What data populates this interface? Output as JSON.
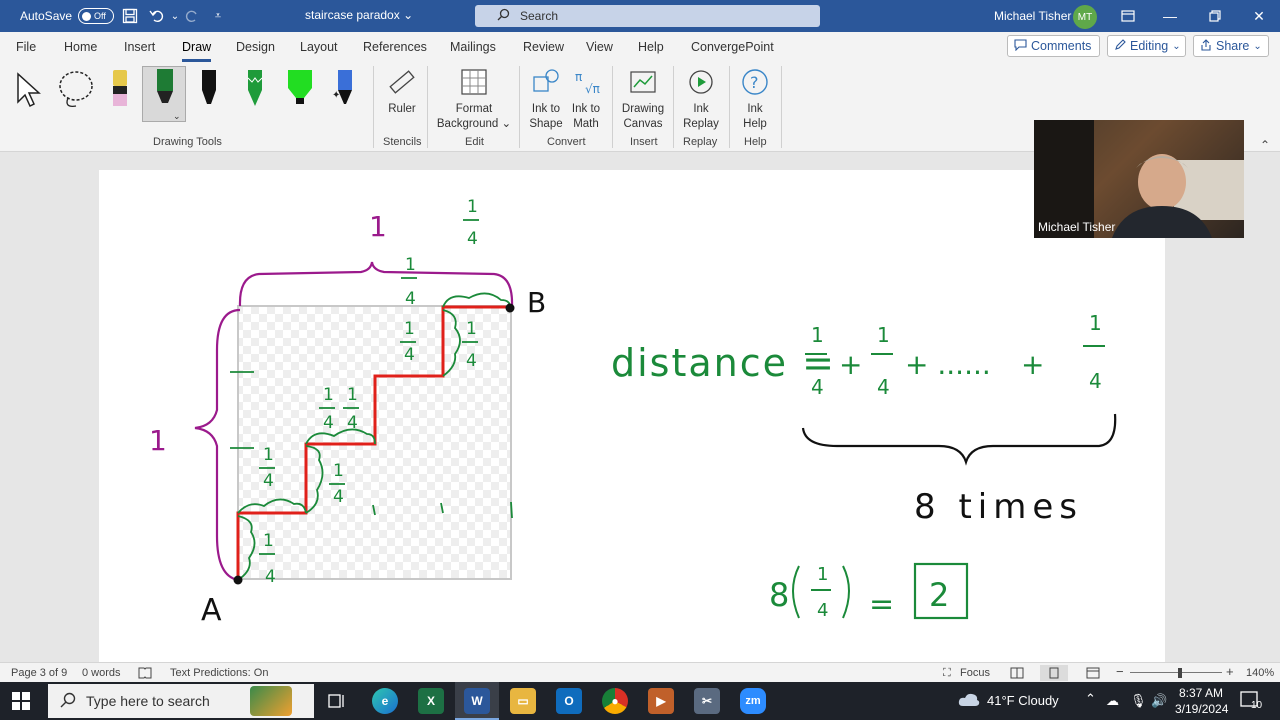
{
  "titlebar": {
    "autosave_label": "AutoSave",
    "autosave_state": "Off",
    "document_title": "staircase paradox",
    "search_placeholder": "Search",
    "user_name": "Michael Tisher",
    "user_initials": "MT"
  },
  "menu": {
    "tabs": [
      "File",
      "Home",
      "Insert",
      "Draw",
      "Design",
      "Layout",
      "References",
      "Mailings",
      "Review",
      "View",
      "Help",
      "ConvergePoint"
    ],
    "active_tab": "Draw",
    "comments_label": "Comments",
    "editing_label": "Editing",
    "share_label": "Share"
  },
  "ribbon": {
    "groups": {
      "drawing_tools": "Drawing Tools",
      "stencils": "Stencils",
      "edit": "Edit",
      "convert": "Convert",
      "insert": "Insert",
      "replay": "Replay",
      "help": "Help"
    },
    "buttons": {
      "ruler": "Ruler",
      "format_background_1": "Format",
      "format_background_2": "Background",
      "ink_to_shape_1": "Ink to",
      "ink_to_shape_2": "Shape",
      "ink_to_math_1": "Ink to",
      "ink_to_math_2": "Math",
      "drawing_canvas_1": "Drawing",
      "drawing_canvas_2": "Canvas",
      "ink_replay_1": "Ink",
      "ink_replay_2": "Replay",
      "ink_help_1": "Ink",
      "ink_help_2": "Help"
    },
    "pen_colors": [
      "#e8b4d8",
      "#1e7b34",
      "#111111",
      "#1e9b3a",
      "#22dd22",
      "#3a6fd8"
    ]
  },
  "drawing": {
    "label_A": "A",
    "label_B": "B",
    "side_top": "1",
    "side_left": "1",
    "quarter_num": "1",
    "quarter_den": "4",
    "equation_lhs": "distance =",
    "plus": "+",
    "ellipsis": "+ ......",
    "times_label": "8 times",
    "eight": "8",
    "equals": "=",
    "result": "2",
    "colors": {
      "ink_green": "#1b8a3a",
      "ink_red": "#e0201a",
      "ink_purple": "#9b1a8c",
      "ink_black": "#111111"
    }
  },
  "webcam": {
    "name": "Michael Tisher"
  },
  "statusbar": {
    "page": "Page 3 of 9",
    "words": "0 words",
    "text_predictions": "Text Predictions: On",
    "focus": "Focus",
    "zoom": "140%"
  },
  "taskbar": {
    "search_placeholder": "Type here to search",
    "weather": "41°F  Cloudy",
    "time": "8:37 AM",
    "date": "3/19/2024",
    "notifications": "10"
  }
}
